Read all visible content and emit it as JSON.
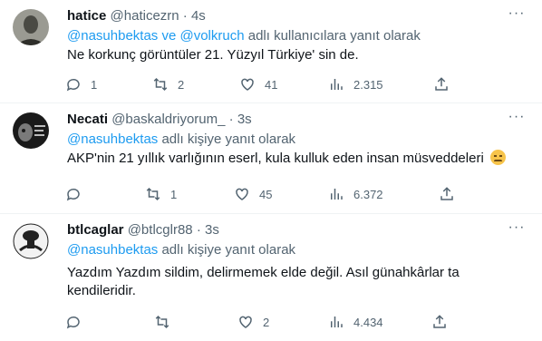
{
  "tweets": [
    {
      "name": "hatice",
      "handle": "@haticezrn",
      "separator": "·",
      "time": "4s",
      "reply_mentions": "@nasuhbektas ve @volkruch",
      "reply_suffix": "adlı kullanıcılara yanıt olarak",
      "text": "Ne korkunç görüntüler 21. Yüzyıl Türkiye' sin de.",
      "replies": "1",
      "retweets": "2",
      "likes": "41",
      "views": "2.315"
    },
    {
      "name": "Necati",
      "handle": "@baskaldriyorum_",
      "separator": "·",
      "time": "3s",
      "reply_mentions": "@nasuhbektas",
      "reply_suffix": "adlı kişiye yanıt olarak",
      "text": "AKP'nin 21 yıllık varlığının eserl, kula kulluk eden insan müsveddeleri",
      "replies": "",
      "retweets": "1",
      "likes": "45",
      "views": "6.372"
    },
    {
      "name": "btlcaglar",
      "handle": "@btlcglr88",
      "separator": "·",
      "time": "3s",
      "reply_mentions": "@nasuhbektas",
      "reply_suffix": "adlı kişiye yanıt olarak",
      "text": "Yazdım Yazdım sildim, delirmemek elde değil. Asıl günahkârlar ta kendileridir.",
      "replies": "",
      "retweets": "",
      "likes": "2",
      "views": "4.434"
    }
  ],
  "icons": {
    "reply": "reply-icon",
    "retweet": "retweet-icon",
    "like": "heart-icon",
    "views": "views-icon",
    "share": "share-icon",
    "more": "more-icon"
  },
  "colors": {
    "link": "#1d9bf0",
    "secondary_text": "#536471",
    "primary_text": "#0f1419"
  }
}
